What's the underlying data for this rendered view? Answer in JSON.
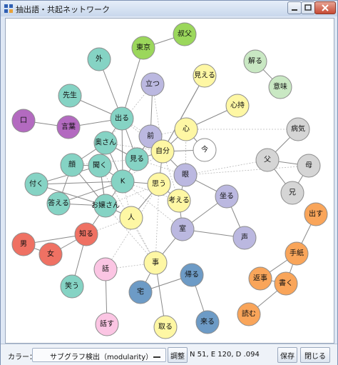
{
  "window": {
    "title": "抽出語・共起ネットワーク"
  },
  "colors": {
    "sub_teal": "#85d3c4",
    "sub_lavender": "#bbb8e0",
    "sub_yellow": "#fef7a4",
    "sub_purple": "#b36ac0",
    "sub_green": "#9bd75b",
    "sub_lightgreen": "#c9e8c3",
    "sub_gray": "#d5d5d5",
    "sub_orange": "#f9a55a",
    "sub_red": "#ef7163",
    "sub_pink": "#fbc5e3",
    "sub_blue": "#6d9bc6",
    "sub_white": "#ffffff"
  },
  "network": {
    "nodes": [
      {
        "id": "kyofu",
        "label": "叔父",
        "color": "#9bd75b"
      },
      {
        "id": "tokyo",
        "label": "東京",
        "color": "#9bd75b"
      },
      {
        "id": "soto",
        "label": "外",
        "color": "#85d3c4"
      },
      {
        "id": "wakaru",
        "label": "解る",
        "color": "#c9e8c3"
      },
      {
        "id": "imi",
        "label": "意味",
        "color": "#c9e8c3"
      },
      {
        "id": "mieru",
        "label": "見える",
        "color": "#fef7a4"
      },
      {
        "id": "tatsu",
        "label": "立つ",
        "color": "#bbb8e0"
      },
      {
        "id": "sensei",
        "label": "先生",
        "color": "#85d3c4"
      },
      {
        "id": "shinji",
        "label": "心持",
        "color": "#fef7a4"
      },
      {
        "id": "kuchi",
        "label": "口",
        "color": "#b36ac0"
      },
      {
        "id": "kotoba",
        "label": "言葉",
        "color": "#b36ac0"
      },
      {
        "id": "deru",
        "label": "出る",
        "color": "#85d3c4"
      },
      {
        "id": "kokoro",
        "label": "心",
        "color": "#fef7a4"
      },
      {
        "id": "byoki",
        "label": "病気",
        "color": "#d5d5d5"
      },
      {
        "id": "mae",
        "label": "前",
        "color": "#bbb8e0"
      },
      {
        "id": "okusan",
        "label": "奥さん",
        "color": "#85d3c4"
      },
      {
        "id": "jibun",
        "label": "自分",
        "color": "#fef7a4"
      },
      {
        "id": "ima",
        "label": "今",
        "color": "#ffffff"
      },
      {
        "id": "chichi",
        "label": "父",
        "color": "#d5d5d5"
      },
      {
        "id": "haha",
        "label": "母",
        "color": "#d5d5d5"
      },
      {
        "id": "kao",
        "label": "顔",
        "color": "#85d3c4"
      },
      {
        "id": "kiku",
        "label": "聞く",
        "color": "#85d3c4"
      },
      {
        "id": "miru",
        "label": "見る",
        "color": "#85d3c4"
      },
      {
        "id": "me",
        "label": "眼",
        "color": "#bbb8e0"
      },
      {
        "id": "K",
        "label": "K",
        "color": "#85d3c4"
      },
      {
        "id": "omou",
        "label": "思う",
        "color": "#fef7a4"
      },
      {
        "id": "tsuku",
        "label": "付く",
        "color": "#85d3c4"
      },
      {
        "id": "ani",
        "label": "兄",
        "color": "#d5d5d5"
      },
      {
        "id": "suwaru",
        "label": "坐る",
        "color": "#bbb8e0"
      },
      {
        "id": "kangaeru",
        "label": "考える",
        "color": "#fef7a4"
      },
      {
        "id": "kotaeru",
        "label": "答える",
        "color": "#85d3c4"
      },
      {
        "id": "ojosan",
        "label": "お嬢さん",
        "color": "#85d3c4"
      },
      {
        "id": "deru2",
        "label": "出す",
        "color": "#f9a55a"
      },
      {
        "id": "hito",
        "label": "人",
        "color": "#fef7a4"
      },
      {
        "id": "otoko",
        "label": "男",
        "color": "#ef7163"
      },
      {
        "id": "shiru",
        "label": "知る",
        "color": "#ef7163"
      },
      {
        "id": "heya",
        "label": "室",
        "color": "#bbb8e0"
      },
      {
        "id": "koe",
        "label": "声",
        "color": "#bbb8e0"
      },
      {
        "id": "onna",
        "label": "女",
        "color": "#ef7163"
      },
      {
        "id": "koto",
        "label": "事",
        "color": "#fef7a4"
      },
      {
        "id": "tegami",
        "label": "手紙",
        "color": "#f9a55a"
      },
      {
        "id": "hanashi",
        "label": "話",
        "color": "#fbc5e3"
      },
      {
        "id": "henji",
        "label": "返事",
        "color": "#f9a55a"
      },
      {
        "id": "kaeru",
        "label": "帰る",
        "color": "#6d9bc6"
      },
      {
        "id": "warau",
        "label": "笑う",
        "color": "#85d3c4"
      },
      {
        "id": "kaku",
        "label": "書く",
        "color": "#f9a55a"
      },
      {
        "id": "taku",
        "label": "宅",
        "color": "#6d9bc6"
      },
      {
        "id": "yomu",
        "label": "読む",
        "color": "#f9a55a"
      },
      {
        "id": "hanasu",
        "label": "話す",
        "color": "#fbc5e3"
      },
      {
        "id": "toru",
        "label": "取る",
        "color": "#fef7a4"
      },
      {
        "id": "kuru",
        "label": "来る",
        "color": "#6d9bc6"
      }
    ]
  },
  "toolbar": {
    "color_label": "カラー：",
    "color_value": "サブグラフ検出（modularity）",
    "adjust_label": "調整",
    "stats": "N 51, E 120, D .094",
    "save_label": "保存",
    "close_label": "閉じる"
  }
}
